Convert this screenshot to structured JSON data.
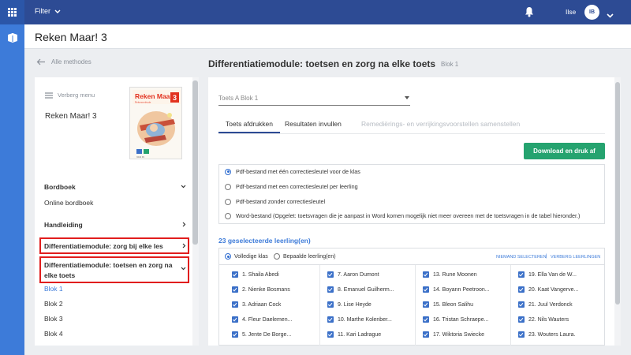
{
  "topbar": {
    "filter_label": "Filter",
    "user_name": "Ilse",
    "avatar_initials": "IB"
  },
  "app_title": "Reken Maar! 3",
  "breadcrumb": {
    "back_label": "Alle methodes"
  },
  "module": {
    "title": "Differentiatiemodule: toetsen en zorg na elke toets",
    "subtitle": "Blok 1"
  },
  "sidebar": {
    "hide_menu_label": "Verberg menu",
    "book_title": "Reken Maar! 3",
    "cover": {
      "title": "Reken Maar!",
      "number": "3",
      "subtitle": "Rekenmethode"
    },
    "items": [
      {
        "label": "Bordboek",
        "bold": true,
        "chevron": "down"
      },
      {
        "label": "Online bordboek",
        "bold": false
      },
      {
        "label": "Handleiding",
        "bold": true,
        "chevron": "right"
      },
      {
        "label": "Differentiatiemodule: zorg bij elke les",
        "bold": true,
        "chevron": "right"
      },
      {
        "label": "Differentiatiemodule: toetsen en zorg na elke toets",
        "bold": true,
        "chevron": "down"
      }
    ],
    "blocks": [
      "Blok 1",
      "Blok 2",
      "Blok 3",
      "Blok 4"
    ]
  },
  "main": {
    "test_select": "Toets A Blok 1",
    "tabs": [
      {
        "label": "Toets afdrukken",
        "active": true
      },
      {
        "label": "Resultaten invullen",
        "active": false
      },
      {
        "label": "Remediërings- en verrijkingsvoorstellen samenstellen",
        "active": false,
        "disabled": true
      }
    ],
    "download_button": "Download en druk af",
    "options": [
      {
        "label": "Pdf-bestand met één correctiesleutel voor de klas",
        "selected": true
      },
      {
        "label": "Pdf-bestand met een correctiesleutel per leerling",
        "selected": false
      },
      {
        "label": "Pdf-bestand zonder correctiesleutel",
        "selected": false
      },
      {
        "label": "Word-bestand (Opgelet: toetsvragen die je aanpast in Word komen mogelijk niet meer overeen met de toetsvragen in de tabel hieronder.)",
        "selected": false
      }
    ],
    "selected_count": "23 geselecteerde leerling(en)",
    "student_scope": [
      {
        "label": "Volledige klas",
        "selected": true
      },
      {
        "label": "Bepaalde leerling(en)",
        "selected": false
      }
    ],
    "deselect_all": "NIEMAND SELECTEREN",
    "link_separator": "|",
    "hide_students": "VERBERG LEERLINGEN",
    "students": [
      [
        "1. Shaila Abedi",
        "2. Nienke Bosmans",
        "3. Adriaan Cock",
        "4. Fleur Daelemen...",
        "5. Jente De Borge..."
      ],
      [
        "7. Aaron Dumont",
        "8. Emanuel Guilherm...",
        "9. Lise Heyde",
        "10. Marthe Kolenber...",
        "11. Kari Ladrague"
      ],
      [
        "13. Rune Moonen",
        "14. Boyann Peetroon...",
        "15. Bleon Salihu",
        "16. Tristan Schraepe...",
        "17. Wiktoria Swiecke"
      ],
      [
        "19. Ella Van de W...",
        "20. Kaat Vangerve...",
        "21. Juul Verdonck",
        "22. Nils Wauters",
        "23. Wouters Laura."
      ]
    ]
  },
  "colors": {
    "rail": "#3d7bd9",
    "topbar": "#2d4b94",
    "accent": "#3d7bd9",
    "download": "#25a36f",
    "highlight": "#e11d1d"
  }
}
